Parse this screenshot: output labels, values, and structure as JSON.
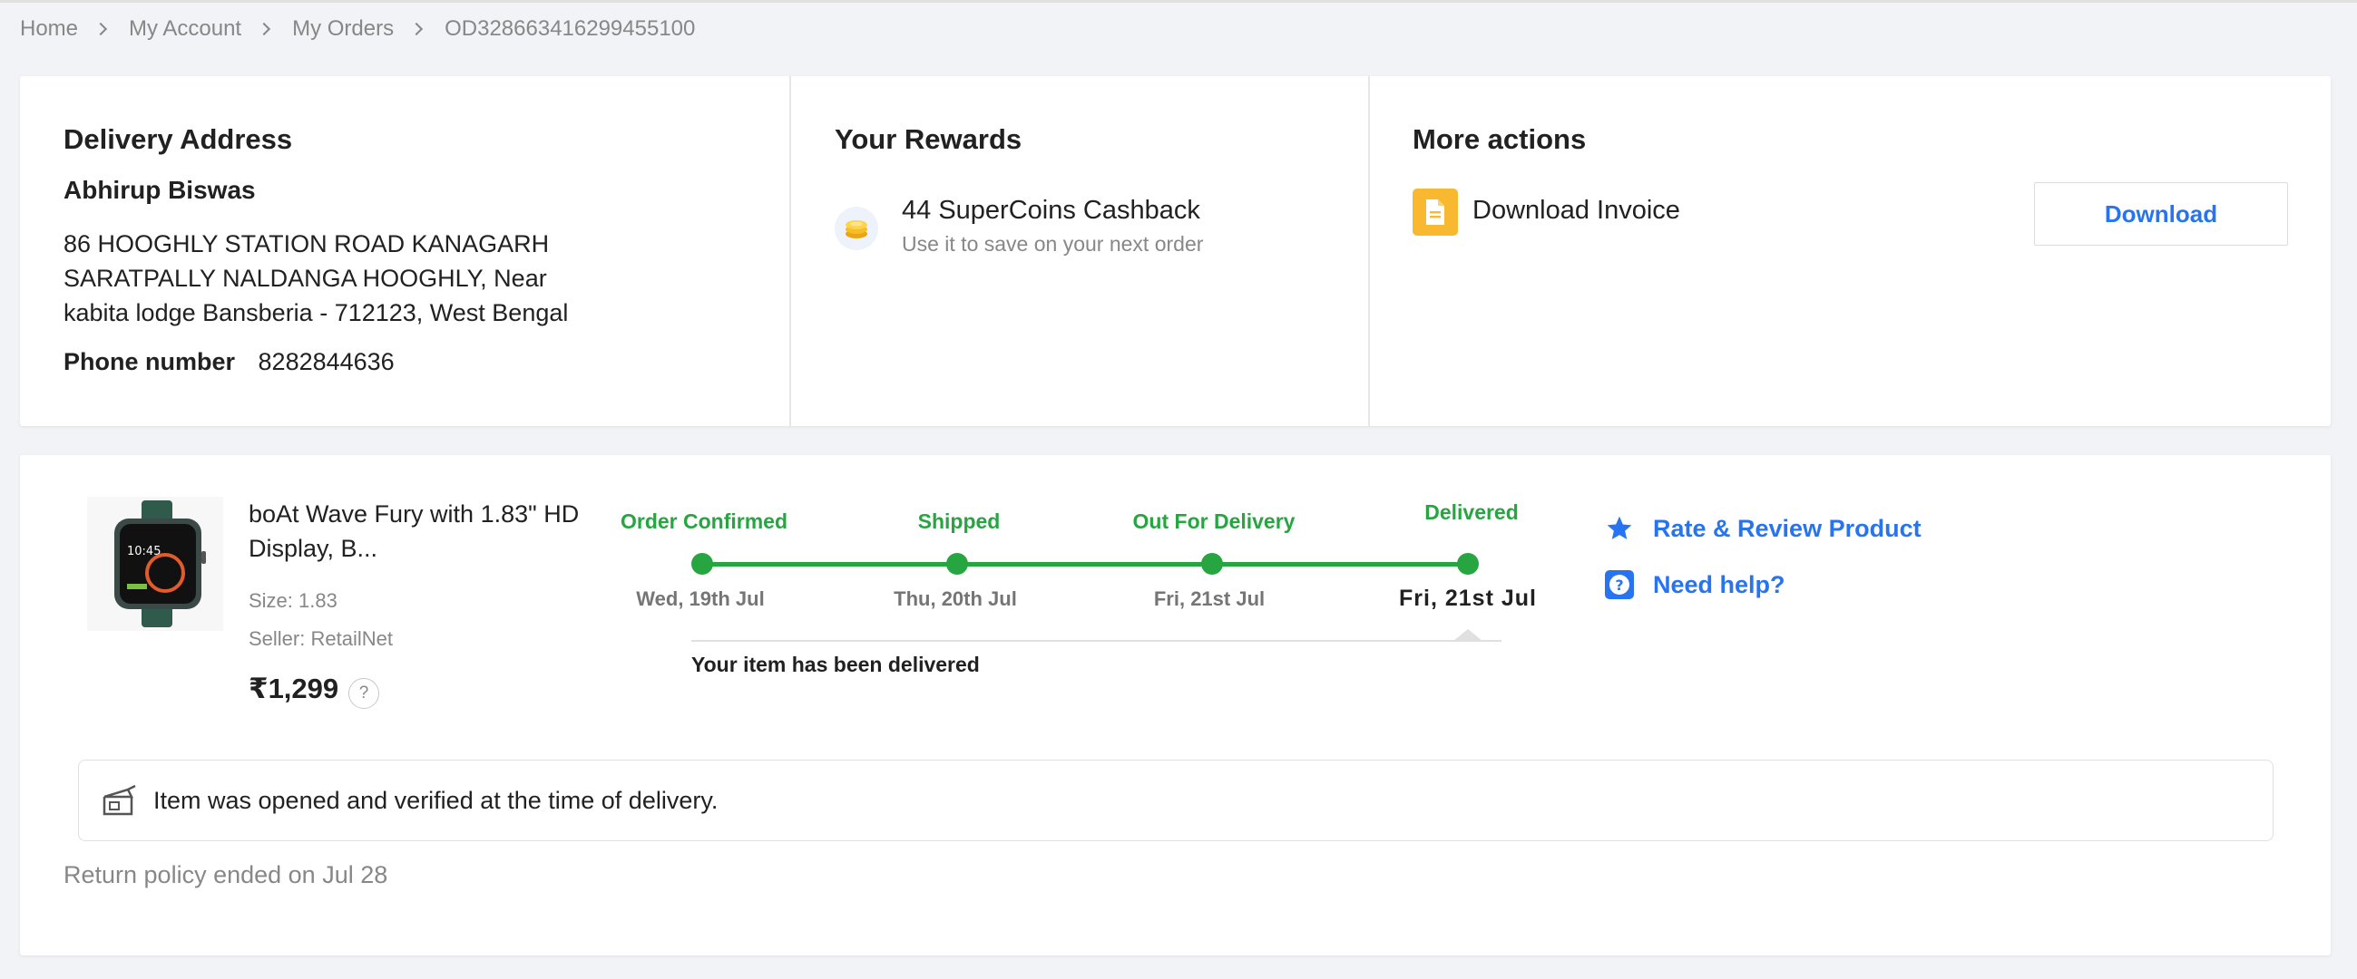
{
  "breadcrumb": {
    "items": [
      "Home",
      "My Account",
      "My Orders"
    ],
    "order_id": "OD328663416299455100"
  },
  "delivery": {
    "title": "Delivery Address",
    "name": "Abhirup Biswas",
    "address_lines": [
      "86 HOOGHLY STATION ROAD KANAGARH",
      "SARATPALLY NALDANGA HOOGHLY, Near",
      "kabita lodge Bansberia - 712123, West Bengal"
    ],
    "phone_label": "Phone number",
    "phone": "8282844636"
  },
  "rewards": {
    "title": "Your Rewards",
    "main": "44 SuperCoins Cashback",
    "sub": "Use it to save on your next order",
    "icon": "supercoin-icon"
  },
  "more_actions": {
    "title": "More actions",
    "invoice_label": "Download Invoice",
    "download_button": "Download",
    "icon": "invoice-icon"
  },
  "product": {
    "name": "boAt Wave Fury with 1.83\" HD Display, B...",
    "size": "Size: 1.83",
    "seller": "Seller: RetailNet",
    "price": "₹1,299",
    "help_mark": "?"
  },
  "tracker": {
    "steps": [
      {
        "label": "Order Confirmed",
        "date": "Wed, 19th Jul"
      },
      {
        "label": "Shipped",
        "date": "Thu, 20th Jul"
      },
      {
        "label": "Out For Delivery",
        "date": "Fri, 21st Jul"
      },
      {
        "label": "Delivered",
        "date": "Fri, 21st Jul"
      }
    ],
    "status_text": "Your item has been delivered",
    "color": "#26a541"
  },
  "actions": {
    "rate": "Rate & Review Product",
    "help": "Need help?"
  },
  "verification": {
    "text": "Item was opened and verified at the time of delivery."
  },
  "return_policy": "Return policy ended on Jul 28",
  "colors": {
    "accent": "#2874f0",
    "success": "#26a541",
    "invoice": "#f8b830"
  }
}
